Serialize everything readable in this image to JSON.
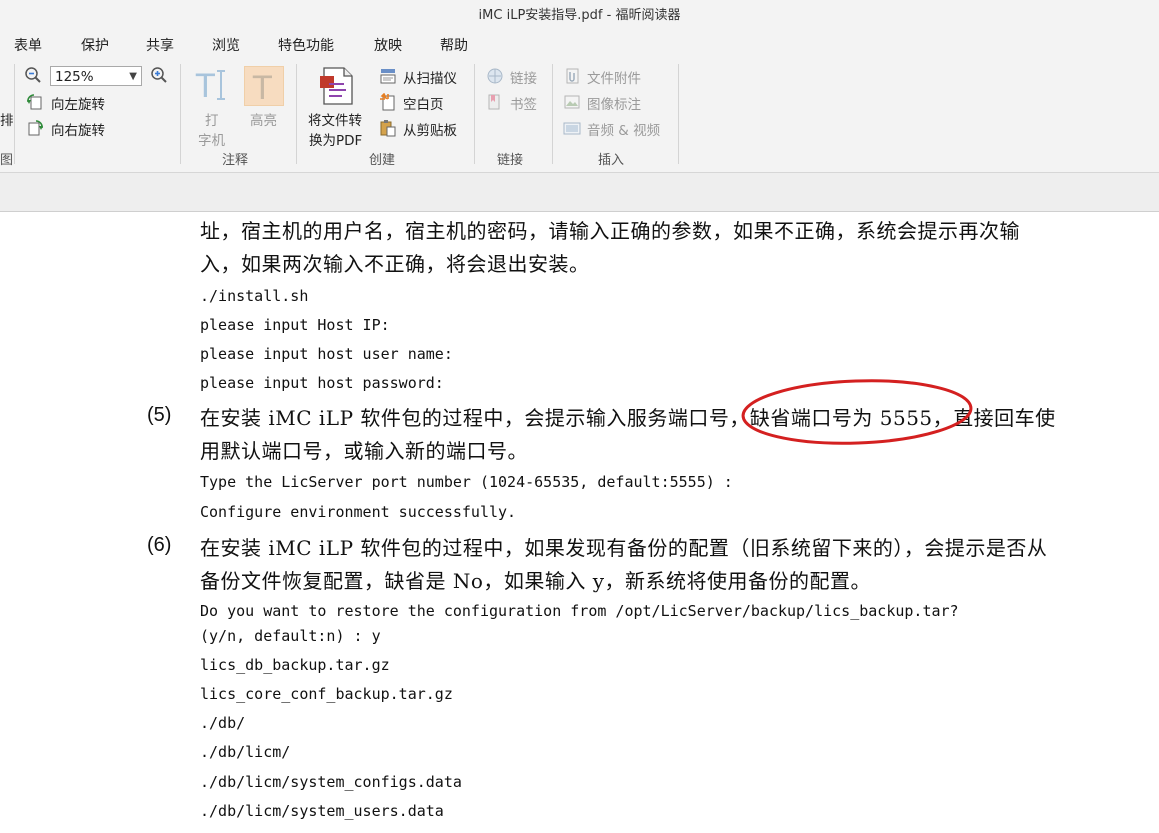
{
  "window": {
    "title": "iMC iLP安装指导.pdf - 福昕阅读器"
  },
  "menu": [
    "表单",
    "保护",
    "共享",
    "浏览",
    "特色功能",
    "放映",
    "帮助"
  ],
  "ribbon": {
    "edge_left_top": "排",
    "edge_left_bottom": "图",
    "zoom_value": "125%",
    "rotate_left": "向左旋转",
    "rotate_right": "向右旋转",
    "typewriter_line1": "打",
    "typewriter_line2": "字机",
    "highlight": "高亮",
    "annotate_group": "注释",
    "convert_line1": "将文件转",
    "convert_line2": "换为PDF",
    "from_scanner": "从扫描仪",
    "blank_page": "空白页",
    "from_clipboard": "从剪贴板",
    "create_group": "创建",
    "link": "链接",
    "bookmark": "书签",
    "links_group": "链接",
    "file_attachment": "文件附件",
    "image_annotation": "图像标注",
    "audio_video": "音频 & 视频",
    "insert_group": "插入"
  },
  "doc": {
    "p1_line1": "址，宿主机的用户名，宿主机的密码，请输入正确的参数，如果不正确，系统会提示再次输",
    "p1_line2": "入，如果两次输入不正确，将会退出安装。",
    "code1": [
      "./install.sh",
      "please input Host IP:",
      "please input host user name:",
      "please input host password:"
    ],
    "step5_num": "(5)",
    "step5_line1": "在安装 iMC iLP 软件包的过程中，会提示输入服务端口号，缺省端口号为 5555，直接回车使",
    "step5_line2": "用默认端口号，或输入新的端口号。",
    "code2": [
      "Type the LicServer port number (1024-65535, default:5555) :",
      "Configure environment successfully."
    ],
    "step6_num": "(6)",
    "step6_line1": "在安装 iMC iLP 软件包的过程中，如果发现有备份的配置（旧系统留下来的），会提示是否从",
    "step6_line2": "备份文件恢复配置，缺省是 No，如果输入 y，新系统将使用备份的配置。",
    "code3": [
      "Do you want to restore the configuration from /opt/LicServer/backup/lics_backup.tar?",
      "(y/n, default:n) : y",
      "lics_db_backup.tar.gz",
      "lics_core_conf_backup.tar.gz",
      "./db/",
      "./db/licm/",
      "./db/licm/system_configs.data",
      "./db/licm/system_users.data"
    ]
  },
  "colors": {
    "annotation_ellipse": "#d42020",
    "ribbon_bg": "#f3f3f3",
    "highlight_bg": "#f7dcc0"
  }
}
